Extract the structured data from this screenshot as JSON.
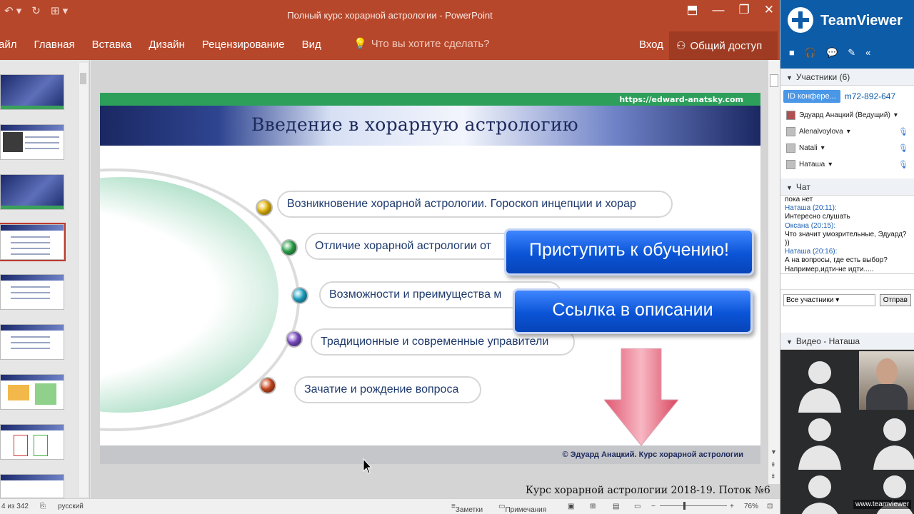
{
  "window": {
    "title": "Полный курс хорарной астрологии - PowerPoint",
    "controls": [
      "restore-ribbon",
      "minimize",
      "maximize",
      "close"
    ]
  },
  "ribbon": {
    "tabs": [
      "айл",
      "Главная",
      "Вставка",
      "Дизайн",
      "Рецензирование",
      "Вид"
    ],
    "tell_me": "Что вы хотите сделать?",
    "signin": "Вход",
    "share": "Общий доступ"
  },
  "slide": {
    "site": "https://edward-anatsky.com",
    "title": "Введение в хорарную астрологию",
    "items": [
      {
        "text": "Возникновение хорарной астрологии. Гороскоп инцепции и хорар",
        "color": "#e8b90c"
      },
      {
        "text": "Отличие хорарной астрологии от",
        "color": "#2fa84f"
      },
      {
        "text": "Возможности и преимущества м",
        "color": "#22a8c9"
      },
      {
        "text": "Традиционные и современные управители",
        "color": "#7e4ec8"
      },
      {
        "text": "Зачатие и рождение вопроса",
        "color": "#cf4a1f"
      }
    ],
    "copyright": "© Эдуард Анацкий. Курс хорарной астрологии"
  },
  "overlay": {
    "btn_start": "Приступить к обучению!",
    "btn_link": "Ссылка в описании",
    "watermark": "Курс хорарной астрологии 2018-19. Поток №6"
  },
  "status": {
    "slide": "4 из 342",
    "lang": "русский",
    "notes": "Заметки",
    "comments": "Примечания",
    "zoom": "76%"
  },
  "teamviewer": {
    "brand": "TeamViewer",
    "participants_header": "Участники (6)",
    "conf_id_label": "ID конфере...",
    "conf_id": "m72-892-647",
    "participants": [
      "Эдуард Анацкий (Ведущий)",
      "Alenalvoylova",
      "Natali",
      "Наташа"
    ],
    "chat_header": "Чат",
    "chat": [
      {
        "t": "пока нет",
        "n": false
      },
      {
        "t": "Наташа (20:11):",
        "n": true
      },
      {
        "t": "Интересно слушать",
        "n": false
      },
      {
        "t": "Оксана (20:15):",
        "n": true
      },
      {
        "t": "Что значит умозрительные, Эдуард?",
        "n": false
      },
      {
        "t": "))",
        "n": false
      },
      {
        "t": "Наташа (20:16):",
        "n": true
      },
      {
        "t": "А на вопросы, где есть выбор?",
        "n": false
      },
      {
        "t": "Например,идти-не идти.....",
        "n": false
      }
    ],
    "recipients": "Все участники",
    "send": "Отправ",
    "video_header": "Видео - Наташа",
    "url": "www.teamviewer"
  }
}
